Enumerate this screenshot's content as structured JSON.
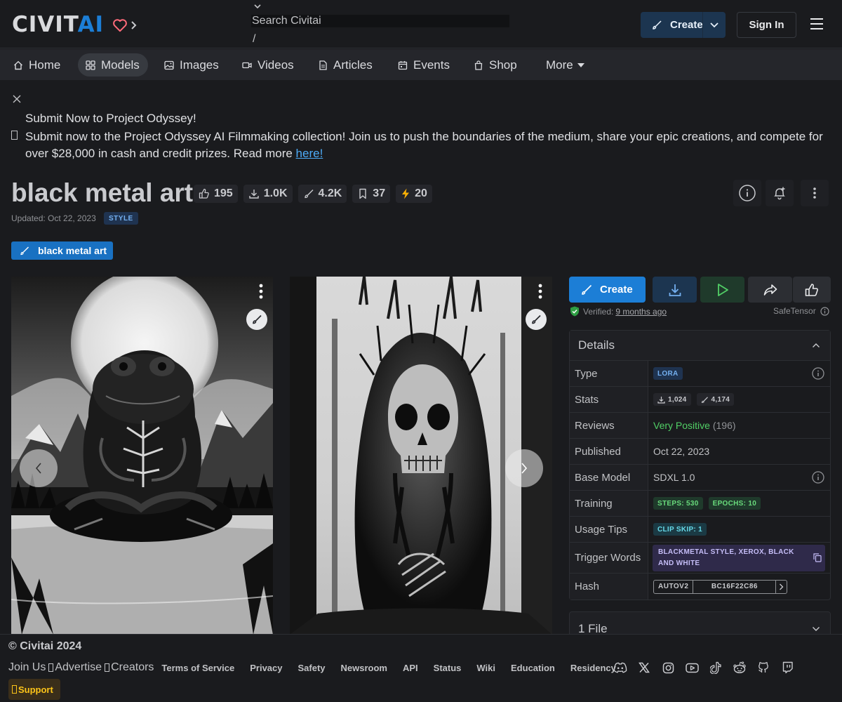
{
  "header": {
    "logo_civit": "CIVIT",
    "logo_ai": "AI",
    "search_placeholder": "Search Civitai",
    "search_shortcut": "/",
    "create_label": "Create",
    "signin_label": "Sign In"
  },
  "nav": {
    "items": [
      {
        "label": "Home",
        "icon": "home-icon"
      },
      {
        "label": "Models",
        "icon": "grid-icon",
        "active": true
      },
      {
        "label": "Images",
        "icon": "photo-icon"
      },
      {
        "label": "Videos",
        "icon": "video-icon"
      },
      {
        "label": "Articles",
        "icon": "file-text-icon"
      },
      {
        "label": "Events",
        "icon": "calendar-icon"
      },
      {
        "label": "Shop",
        "icon": "shopping-bag-icon"
      },
      {
        "label": "More",
        "icon": "caret-down-icon"
      }
    ]
  },
  "announcement": {
    "title": "Submit Now to Project Odyssey!",
    "body": "Submit now to the Project Odyssey AI Filmmaking collection! Join us to push the boundaries of the medium, share your epic creations, and compete for over $28,000 in cash and credit prizes. Read more ",
    "link_text": "here!"
  },
  "model": {
    "title": "black metal art",
    "stats": {
      "likes": "195",
      "downloads": "1.0K",
      "generations": "4.2K",
      "bookmarks": "37",
      "buzz": "20"
    },
    "updated": "Updated: Oct 22, 2023",
    "category": "STYLE",
    "tag_label": "black metal art"
  },
  "actions": {
    "create_label": "Create",
    "verified_label": "Verified:",
    "verified_date": "9 months ago",
    "safetensor_label": "SafeTensor"
  },
  "details": {
    "header": "Details",
    "rows": {
      "type": {
        "label": "Type",
        "value": "LORA"
      },
      "stats": {
        "label": "Stats",
        "downloads": "1,024",
        "generations": "4,174"
      },
      "reviews": {
        "label": "Reviews",
        "sentiment": "Very Positive",
        "count": "(196)"
      },
      "published": {
        "label": "Published",
        "value": "Oct 22, 2023"
      },
      "base_model": {
        "label": "Base Model",
        "value": "SDXL 1.0"
      },
      "training": {
        "label": "Training",
        "steps": "STEPS: 530",
        "epochs": "EPOCHS: 10"
      },
      "usage_tips": {
        "label": "Usage Tips",
        "clip_skip": "CLIP SKIP: 1"
      },
      "trigger_words": {
        "label": "Trigger Words",
        "value": "BLACKMETAL STYLE, XEROX, BLACK AND WHITE"
      },
      "hash": {
        "label": "Hash",
        "type": "AUTOV2",
        "value": "BC16F22C86"
      }
    }
  },
  "files": {
    "header": "1 File"
  },
  "footer": {
    "copyright": "© Civitai 2024",
    "join_us": "Join Us",
    "advertise": "Advertise",
    "creators": "Creators",
    "links": [
      "Terms of Service",
      "Privacy",
      "Safety",
      "Newsroom",
      "API",
      "Status",
      "Wiki",
      "Education",
      "Residency"
    ],
    "social": [
      "discord-icon",
      "x-icon",
      "instagram-icon",
      "youtube-icon",
      "tiktok-icon",
      "reddit-icon",
      "github-icon",
      "twitch-icon"
    ],
    "support_label": "Support"
  },
  "colors": {
    "background": "#1a1b1e",
    "accent": "#1c7ed6",
    "positive": "#51cf66",
    "support": "#fcc419"
  }
}
